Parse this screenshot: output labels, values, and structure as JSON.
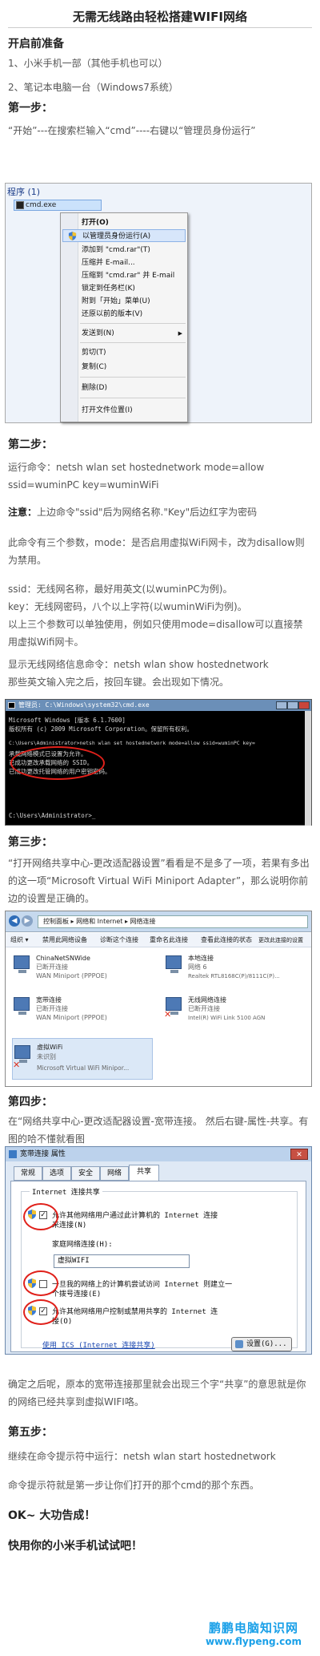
{
  "title": "无需无线路由轻松搭建WIFI网络",
  "prep": {
    "heading": "开启前准备",
    "items": [
      "1、小米手机一部（其他手机也可以）",
      "2、笔记本电脑一台（Windows7系统）"
    ]
  },
  "step1": {
    "heading": "第一步：",
    "text": "“开始”---在搜索栏输入“cmd”----右键以“管理员身份运行”",
    "screenshot": {
      "program_header": "程序 (1)",
      "file": "cmd.exe",
      "menu": [
        "打开(O)",
        "以管理员身份运行(A)",
        "添加到 \"cmd.rar\"(T)",
        "压缩并 E-mail...",
        "压缩到 \"cmd.rar\" 并 E-mail",
        "锁定到任务栏(K)",
        "附到「开始」菜单(U)",
        "还原以前的版本(V)",
        "发送到(N)",
        "剪切(T)",
        "复制(C)",
        "删除(D)",
        "打开文件位置(I)"
      ]
    }
  },
  "step2": {
    "heading": "第二步：",
    "run_cmd": "运行命令：netsh wlan set hostednetwork mode=allow ssid=wuminPC key=wuminWiFi",
    "note_label": "注意：",
    "note_text": "上边命令\"ssid\"后为网络名称.\"Key\"后边红字为密码",
    "params": "此命令有三个参数，mode：是否启用虚拟WiFi网卡，改为disallow则为禁用。",
    "ssid": "ssid：无线网名称，最好用英文(以wuminPC为例)。",
    "key": "key：无线网密码，八个以上字符(以wuminWiFi为例)。",
    "single": "以上三个参数可以单独使用，例如只使用mode=disallow可以直接禁用虚拟Wifi网卡。",
    "show_cmd": "显示无线网络信息命令：netsh wlan show hostednetwork",
    "enter": "那些英文输入完之后，按回车键。会出现如下情况。",
    "cmd": {
      "title": "管理员: C:\\Windows\\system32\\cmd.exe",
      "lines": [
        "Microsoft Windows [版本 6.1.7600]",
        "版权所有 (c) 2009 Microsoft Corporation。保留所有权利。",
        "C:\\Users\\Administrator>netsh wlan set hostednetwork mode=allow ssid=wuminPC key=",
        "承载网络模式已设置为允许。",
        "已成功更改承载网络的 SSID。",
        "已成功更改托管网络的用户密钥密码。",
        "C:\\Users\\Administrator>_"
      ]
    }
  },
  "step3": {
    "heading": "第三步：",
    "text": "“打开网络共享中心-更改适配器设置”看看是不是多了一项，若果有多出的这一项“Microsoft Virtual WiFi Miniport Adapter”，那么说明你前边的设置是正确的。",
    "screenshot": {
      "address": "控制面板 ▸ 网络和 Internet ▸ 网络连接",
      "toolbar": [
        "组织 ▾",
        "禁用此网络设备",
        "诊断这个连接",
        "重命名此连接",
        "查看此连接的状态",
        "更改此连接的设置"
      ],
      "adapters": [
        {
          "name": "ChinaNetSNWide",
          "status": "已断开连接",
          "device": "WAN Miniport (PPPOE)"
        },
        {
          "name": "本地连接",
          "status": "网络 6",
          "device": "Realtek RTL8168C(P)/8111C(P)..."
        },
        {
          "name": "宽带连接",
          "status": "已断开连接",
          "device": "WAN Miniport (PPPOE)"
        },
        {
          "name": "无线网络连接",
          "status": "已断开连接",
          "device": "Intel(R) WiFi Link 5100 AGN"
        },
        {
          "name": "虚拟WiFi",
          "status": "未识别",
          "device": "Microsoft Virtual WiFi Minipor..."
        }
      ]
    }
  },
  "step4": {
    "heading": "第四步：",
    "text": "在“网络共享中心-更改适配器设置-宽带连接。 然后右键-属性-共享。有图的哈不懂就看图",
    "dialog": {
      "title": "宽带连接 属性",
      "close": "✕",
      "tabs": [
        "常规",
        "选项",
        "安全",
        "网络",
        "共享"
      ],
      "group_title": "Internet 连接共享",
      "allow_share": [
        "允许其他网络用户通过此计算机的 Internet 连接",
        "来连接(N)"
      ],
      "home_label": "家庭网络连接(H):",
      "home_value": "虚拟WIFI",
      "dial": [
        "一旦我的网络上的计算机尝试访问 Internet 则建立一",
        "个拨号连接(E)"
      ],
      "allow_control": [
        "允许其他网络用户控制或禁用共享的 Internet 连",
        "接(O)"
      ],
      "ics_link": "使用 ICS (Internet 连接共享)",
      "settings_button": "设置(G)..."
    }
  },
  "after": "确定之后呢，原本的宽带连接那里就会出现三个字“共享”的意思就是你的网络已经共享到虚拟WIFI咯。",
  "step5": {
    "heading": "第五步：",
    "text": "继续在命令提示符中运行：netsh wlan start hostednetwork",
    "cmd_note": "命令提示符就是第一步让你们打开的那个cmd的那个东西。"
  },
  "done": "OK~ 大功告成！",
  "try": "快用你的小米手机试试吧！",
  "watermark": {
    "name": "鹏鹏电脑知识网",
    "url": "www.flypeng.com"
  },
  "colors": {
    "link": "#1a47b0",
    "highlight": "#e0201a",
    "brand": "#1aa0e8"
  }
}
